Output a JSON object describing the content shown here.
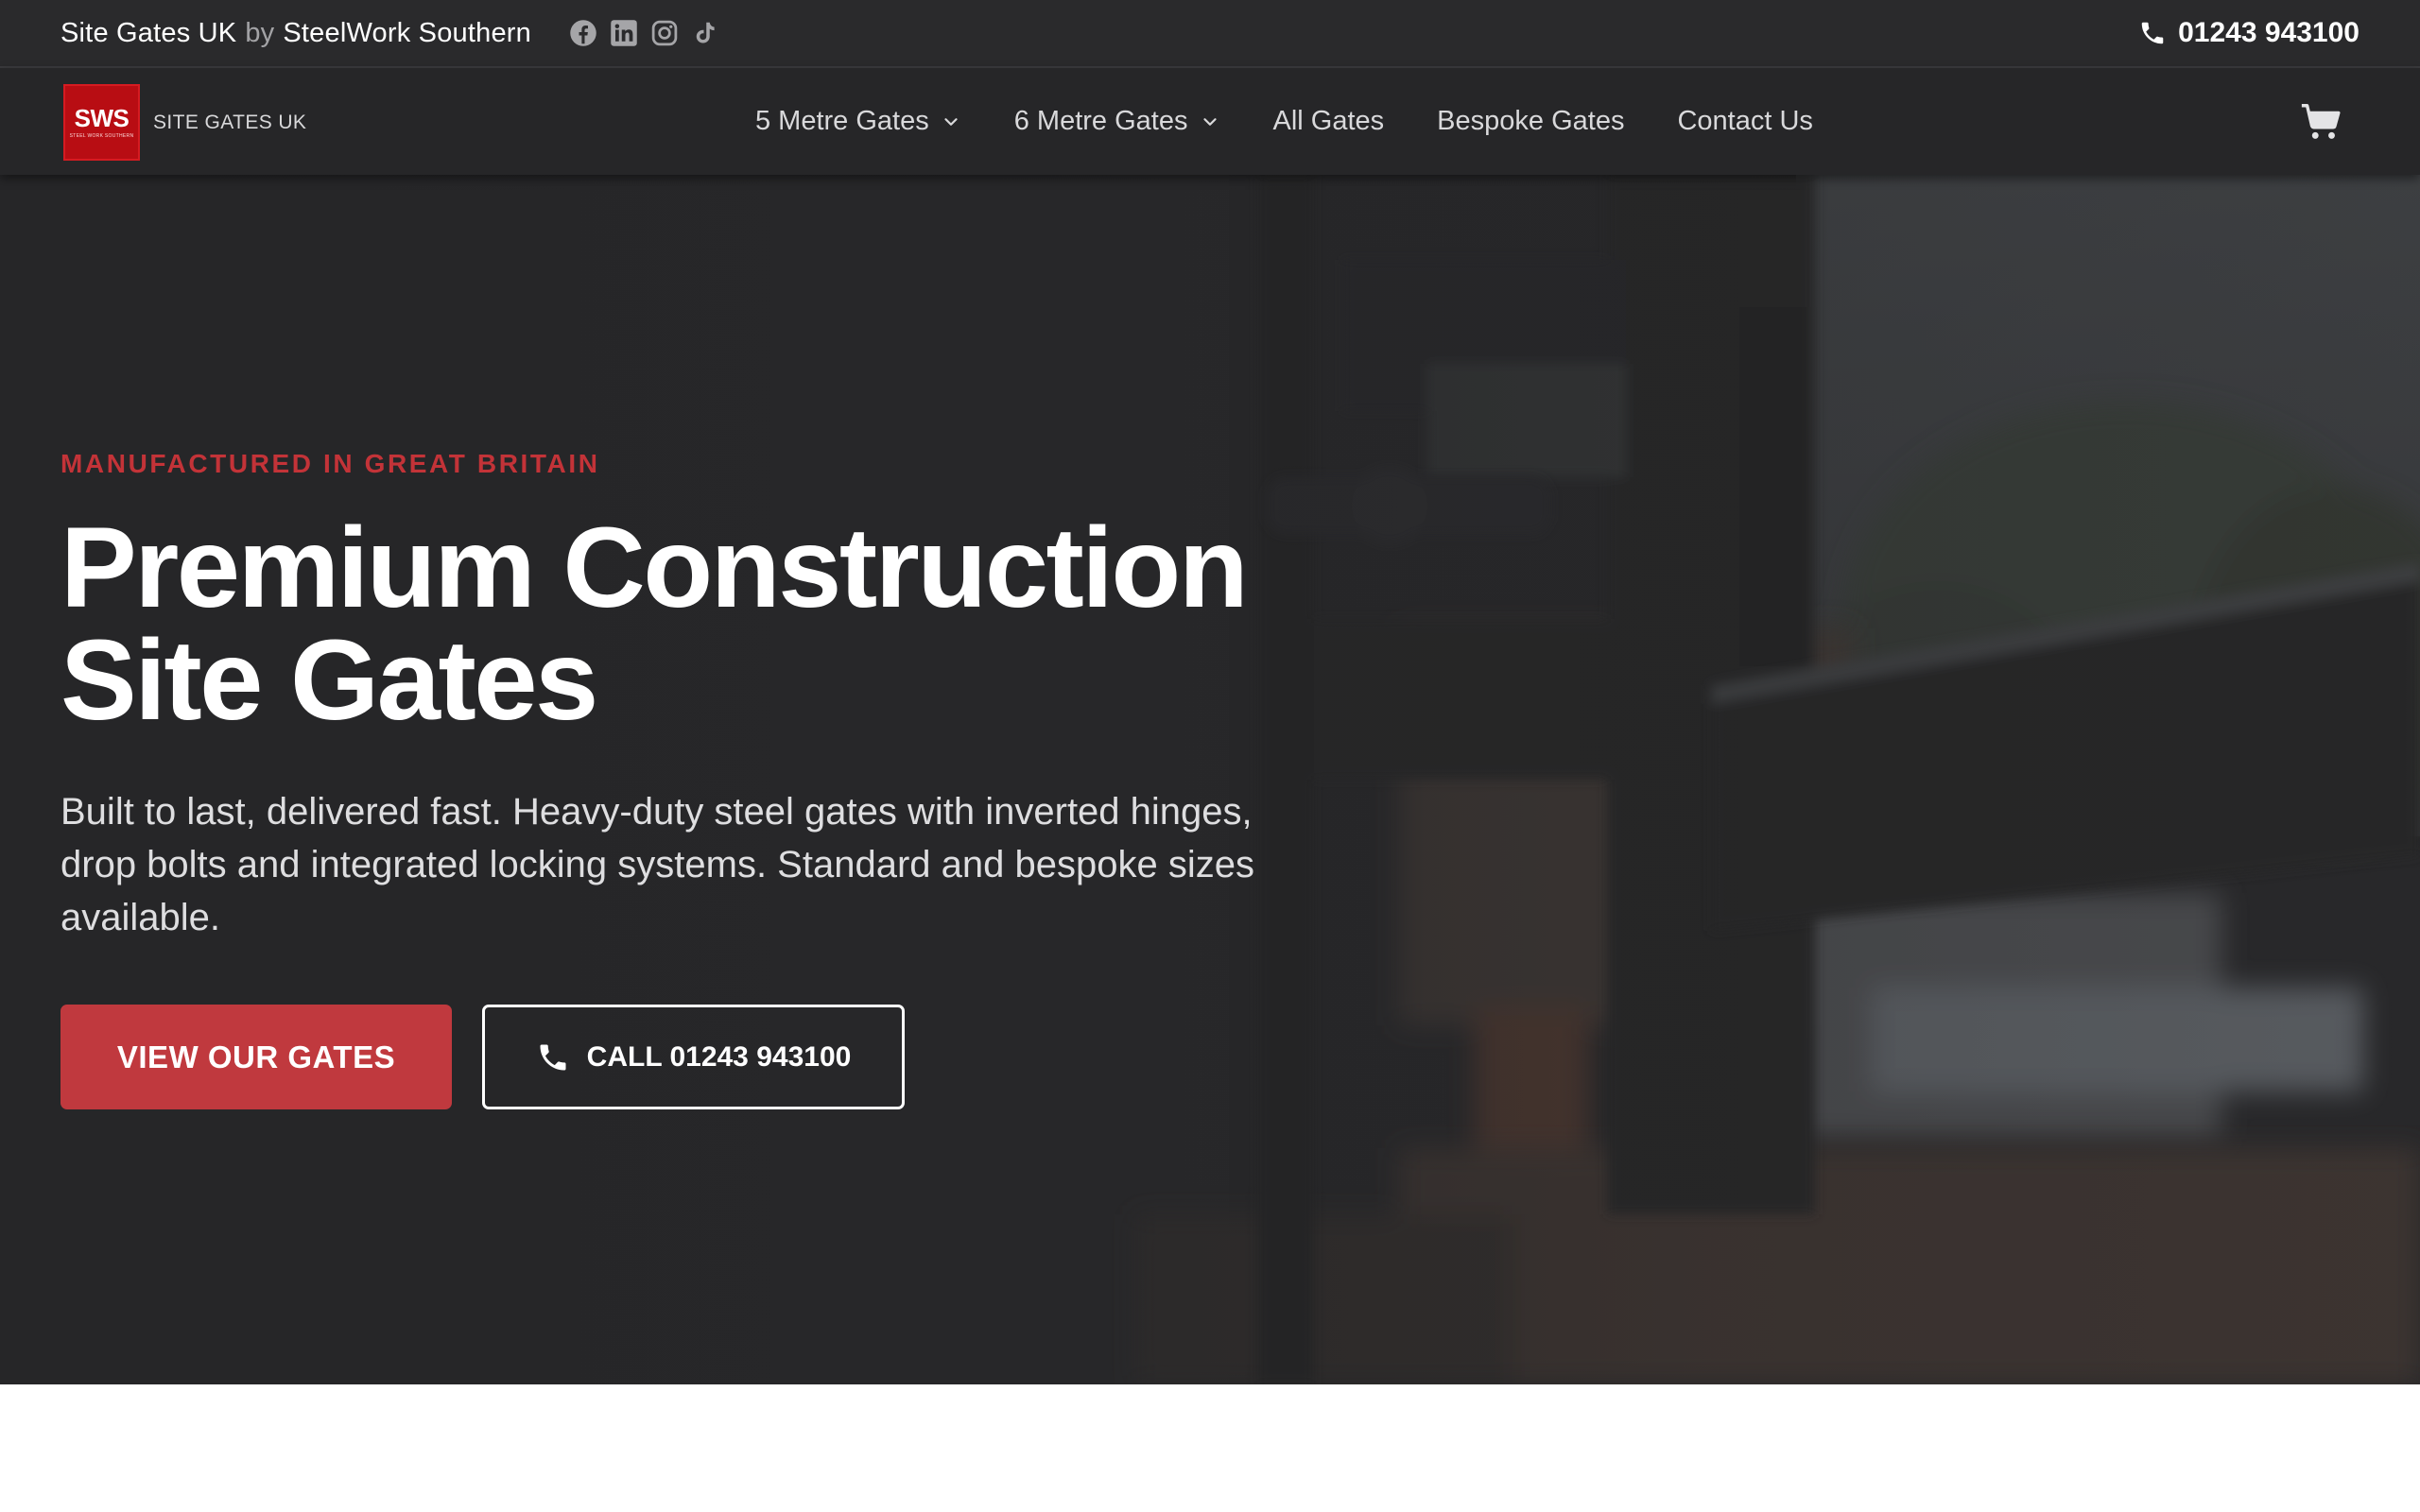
{
  "topbar": {
    "brand_name": "Site Gates UK",
    "brand_by": "by",
    "brand_company": "SteelWork Southern",
    "socials": [
      {
        "icon": "facebook-icon"
      },
      {
        "icon": "linkedin-icon"
      },
      {
        "icon": "instagram-icon"
      },
      {
        "icon": "tiktok-icon"
      }
    ],
    "phone": "01243 943100"
  },
  "nav": {
    "logo_mark": "SWS",
    "logo_tagline": "STEEL WORK SOUTHERN",
    "logo_text": "SITE GATES UK",
    "items": [
      {
        "label": "5 Metre Gates",
        "has_dropdown": true
      },
      {
        "label": "6 Metre Gates",
        "has_dropdown": true
      },
      {
        "label": "All Gates",
        "has_dropdown": false
      },
      {
        "label": "Bespoke Gates",
        "has_dropdown": false
      },
      {
        "label": "Contact Us",
        "has_dropdown": false
      }
    ],
    "cart_icon": "cart-icon"
  },
  "hero": {
    "eyebrow": "MANUFACTURED IN GREAT BRITAIN",
    "headline_line1": "Premium Construction",
    "headline_line2": "Site Gates",
    "subtext": "Built to last, delivered fast. Heavy-duty steel gates with inverted hinges, drop bolts and integrated locking systems. Standard and bespoke sizes available.",
    "primary_cta": "VIEW OUR GATES",
    "secondary_cta": "CALL 01243 943100"
  },
  "colors": {
    "accent": "#c0393e",
    "topbar_bg": "#2a2a2c",
    "navbar_bg": "#262628",
    "logo_red": "#b80d13"
  }
}
